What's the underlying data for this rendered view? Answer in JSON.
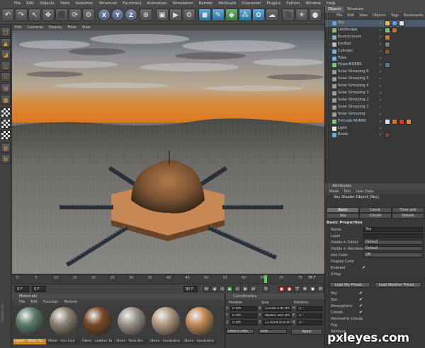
{
  "menubar": [
    "File",
    "Edit",
    "Objects",
    "Tools",
    "Selection",
    "Structure",
    "Functions",
    "Animation",
    "Simulation",
    "Render",
    "MoGraph",
    "Character",
    "Plugins",
    "Python",
    "Window",
    "Help"
  ],
  "viewport_menu": [
    "Edit",
    "Cameras",
    "Display",
    "Filter",
    "View"
  ],
  "timeline": {
    "ticks": [
      "0",
      "5",
      "10",
      "15",
      "20",
      "25",
      "30",
      "35",
      "40",
      "45",
      "50",
      "55",
      "60",
      "65",
      "70",
      "75"
    ],
    "frame_end_label": "76 F",
    "start_field": "0 F",
    "current_field": "0 F",
    "end_field": "90 F"
  },
  "materials": {
    "title": "Materials",
    "menu": [
      "File",
      "Edit",
      "Function",
      "Texture"
    ],
    "items": [
      {
        "label": "Liquid - Water Tur",
        "selected": true,
        "color": "#5a7a6a"
      },
      {
        "label": "Metal - Iron Cast",
        "selected": false,
        "color": "#8a8070"
      },
      {
        "label": "Fabric - Leather Tu",
        "selected": false,
        "color": "#7a4a28"
      },
      {
        "label": "Stone - Rock Bro",
        "selected": false,
        "color": "#9a9288"
      },
      {
        "label": "Stone - Sandstone",
        "selected": false,
        "color": "#b09880"
      },
      {
        "label": "Stone - Sandstone",
        "selected": false,
        "color": "#c08858"
      }
    ]
  },
  "coordinates": {
    "title": "Coordinates",
    "headers": [
      "Position",
      "Size",
      "Rotation"
    ],
    "rows": [
      {
        "pos": "0 cm",
        "size": "51536.376 cm",
        "rot": "0 °",
        "axis_p": "X",
        "axis_s": "X",
        "axis_r": "H"
      },
      {
        "pos": "0 cm",
        "size": "48263.163 cm",
        "rot": "0 °",
        "axis_p": "Y",
        "axis_s": "Y",
        "axis_r": "P"
      },
      {
        "pos": "0 cm",
        "size": "117054.974 cm",
        "rot": "0 °",
        "axis_p": "Z",
        "axis_s": "Z",
        "axis_r": "B"
      }
    ],
    "mode_dropdown": "Object (Rel)",
    "size_dropdown": "Size",
    "apply_label": "Apply"
  },
  "object_manager": {
    "tabs": [
      "Objects",
      "Structure"
    ],
    "menu": [
      "File",
      "Edit",
      "View",
      "Objects",
      "Tags",
      "Bookmarks"
    ],
    "rows": [
      {
        "name": "Sky",
        "selected": true,
        "icon_color": "#6aa0d8"
      },
      {
        "name": "Landscape",
        "selected": false,
        "icon_color": "#8ab87a"
      },
      {
        "name": "Environment",
        "selected": false,
        "icon_color": "#7ab0c8"
      },
      {
        "name": "Emitter",
        "selected": false,
        "icon_color": "#b8b8b8"
      },
      {
        "name": "Cylinder",
        "selected": false,
        "icon_color": "#6ab0e0"
      },
      {
        "name": "Tube",
        "selected": false,
        "icon_color": "#6ab0e0"
      },
      {
        "name": "HyperNURBS",
        "selected": false,
        "icon_color": "#7ac87a"
      },
      {
        "name": "Solar Grouping 6",
        "selected": false,
        "icon_color": "#9a9a9a"
      },
      {
        "name": "Solar Grouping 5",
        "selected": false,
        "icon_color": "#9a9a9a"
      },
      {
        "name": "Solar Grouping 4",
        "selected": false,
        "icon_color": "#9a9a9a"
      },
      {
        "name": "Solar Grouping 3",
        "selected": false,
        "icon_color": "#9a9a9a"
      },
      {
        "name": "Solar Grouping 2",
        "selected": false,
        "icon_color": "#9a9a9a"
      },
      {
        "name": "Solar Grouping 1",
        "selected": false,
        "icon_color": "#9a9a9a"
      },
      {
        "name": "Solar Grouping",
        "selected": false,
        "icon_color": "#9a9a9a"
      },
      {
        "name": "Extrude NURBS",
        "selected": false,
        "icon_color": "#7ac87a"
      },
      {
        "name": "Light",
        "selected": false,
        "icon_color": "#e8e8e8"
      },
      {
        "name": "Boole",
        "selected": false,
        "icon_color": "#6ab0e0"
      }
    ]
  },
  "attribute_manager": {
    "title": "Attributes",
    "menu": [
      "Mode",
      "Edit",
      "User Data"
    ],
    "object_label": "Sky Shader Object [Sky]",
    "tabs_row1": [
      "Basic",
      "Coord.",
      "Time and Location"
    ],
    "tabs_row2": [
      "Sky",
      "Clouds",
      "Details"
    ],
    "section": "Basic Properties",
    "fields": [
      {
        "label": "Name",
        "value": "Sky",
        "kind": "text"
      },
      {
        "label": "Layer",
        "value": "",
        "kind": "text"
      },
      {
        "label": "Visible in Editor",
        "value": "Default",
        "kind": "drop"
      },
      {
        "label": "Visible in Renderer",
        "value": "Default",
        "kind": "drop"
      },
      {
        "label": "Use Color",
        "value": "Off",
        "kind": "drop"
      },
      {
        "label": "Display Color",
        "value": "",
        "kind": "none"
      },
      {
        "label": "Enabled",
        "value": "✔",
        "kind": "check"
      },
      {
        "label": "X-Ray",
        "value": "",
        "kind": "check"
      }
    ],
    "buttons": [
      "Load Sky Preset...",
      "Load Weather Preset..."
    ],
    "checks": [
      {
        "label": "Sky",
        "value": "✔"
      },
      {
        "label": "Sun",
        "value": "✔"
      },
      {
        "label": "Atmosphere",
        "value": "✔"
      },
      {
        "label": "Clouds",
        "value": "✔"
      },
      {
        "label": "Volumetric Clouds",
        "value": ""
      },
      {
        "label": "Fog",
        "value": ""
      },
      {
        "label": "Rainbow",
        "value": ""
      },
      {
        "label": "Sunbeams",
        "value": ""
      }
    ]
  },
  "side_label": "CINEMA 4D",
  "watermark": "pxleyes.com"
}
